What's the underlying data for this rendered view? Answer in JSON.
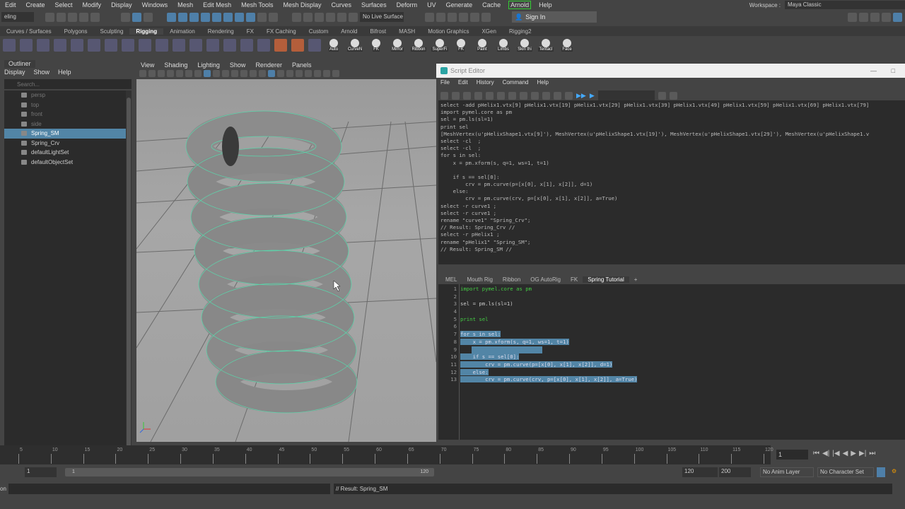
{
  "menubar": {
    "items": [
      "Edit",
      "Create",
      "Select",
      "Modify",
      "Display",
      "Windows",
      "Mesh",
      "Edit Mesh",
      "Mesh Tools",
      "Mesh Display",
      "Curves",
      "Surfaces",
      "Deform",
      "UV",
      "Generate",
      "Cache",
      "Arnold",
      "Help"
    ],
    "workspace_label": "Workspace :",
    "workspace_value": "Maya Classic"
  },
  "toolbar": {
    "mode": "eling",
    "live_surface": "No Live Surface",
    "sign_in": "Sign In"
  },
  "shelf": {
    "tabs": [
      "Curves / Surfaces",
      "Polygons",
      "Sculpting",
      "Rigging",
      "Animation",
      "Rendering",
      "FX",
      "FX Caching",
      "Custom",
      "Arnold",
      "Bifrost",
      "MASH",
      "Motion Graphics",
      "XGen",
      "Rigging2"
    ],
    "active_tab": "Rigging",
    "buttons": [
      "Auto",
      "CurveN",
      "FK",
      "Mirror",
      "Ribbon",
      "SuperFi",
      "FK",
      "Paint",
      "Limbs",
      "Skin thi",
      "Tentacl",
      "Face"
    ]
  },
  "outliner": {
    "title": "Outliner",
    "menu": [
      "Display",
      "Show",
      "Help"
    ],
    "search_placeholder": "Search...",
    "items": [
      {
        "label": "persp",
        "dim": true
      },
      {
        "label": "top",
        "dim": true
      },
      {
        "label": "front",
        "dim": true
      },
      {
        "label": "side",
        "dim": true
      },
      {
        "label": "Spring_SM",
        "selected": true
      },
      {
        "label": "Spring_Crv"
      },
      {
        "label": "defaultLightSet"
      },
      {
        "label": "defaultObjectSet"
      }
    ]
  },
  "viewport": {
    "menu": [
      "View",
      "Shading",
      "Lighting",
      "Show",
      "Renderer",
      "Panels"
    ]
  },
  "script_editor": {
    "title": "Script Editor",
    "menu": [
      "File",
      "Edit",
      "History",
      "Command",
      "Help"
    ],
    "history": [
      "select -add pHelix1.vtx[9] pHelix1.vtx[19] pHelix1.vtx[29] pHelix1.vtx[39] pHelix1.vtx[49] pHelix1.vtx[59] pHelix1.vtx[69] pHelix1.vtx[79]",
      "import pymel.core as pm",
      "sel = pm.ls(sl=1)",
      "print sel",
      "[MeshVertex(u'pHelixShape1.vtx[9]'), MeshVertex(u'pHelixShape1.vtx[19]'), MeshVertex(u'pHelixShape1.vtx[29]'), MeshVertex(u'pHelixShape1.v",
      "select -cl  ;",
      "select -cl  ;",
      "for s in sel:",
      "    x = pm.xform(s, q=1, ws=1, t=1)",
      "",
      "    if s == sel[0]:",
      "        crv = pm.curve(p=[x[0], x[1], x[2]], d=1)",
      "    else:",
      "        crv = pm.curve(crv, p=[x[0], x[1], x[2]], a=True)",
      "select -r curve1 ;",
      "select -r curve1 ;",
      "rename \"curve1\" \"Spring_Crv\";",
      "// Result: Spring_Crv //",
      "select -r pHelix1 ;",
      "rename \"pHelix1\" \"Spring_SM\";",
      "// Result: Spring_SM //"
    ],
    "tabs": [
      "MEL",
      "Mouth Rig",
      "Ribbon",
      "OG AutoRig",
      "FK",
      "Spring Tutorial",
      "+"
    ],
    "active_tab": "Spring Tutorial",
    "code": [
      "import pymel.core as pm",
      "",
      "sel = pm.ls(sl=1)",
      "",
      "print sel",
      "",
      "for s in sel:",
      "    x = pm.xform(s, q=1, ws=1, t=1)",
      "",
      "    if s == sel[0]:",
      "        crv = pm.curve(p=[x[0], x[1], x[2]], d=1)",
      "    else:",
      "        crv = pm.curve(crv, p=[x[0], x[1], x[2]], a=True)"
    ],
    "line_numbers": [
      "1",
      "2",
      "3",
      "4",
      "5",
      "6",
      "7",
      "8",
      "9",
      "10",
      "11",
      "12",
      "13"
    ]
  },
  "timeline": {
    "ticks": [
      "5",
      "10",
      "15",
      "20",
      "25",
      "30",
      "35",
      "40",
      "45",
      "50",
      "55",
      "60",
      "65",
      "70",
      "75",
      "80",
      "85",
      "90",
      "95",
      "100",
      "105",
      "110",
      "115",
      "120"
    ],
    "current_frame": "1"
  },
  "range": {
    "start": "1",
    "range_start": "1",
    "range_end": "120",
    "end": "120",
    "max": "200",
    "anim_layer": "No Anim Layer",
    "character_set": "No Character Set"
  },
  "command": {
    "label": "on",
    "result": "// Result: Spring_SM"
  }
}
